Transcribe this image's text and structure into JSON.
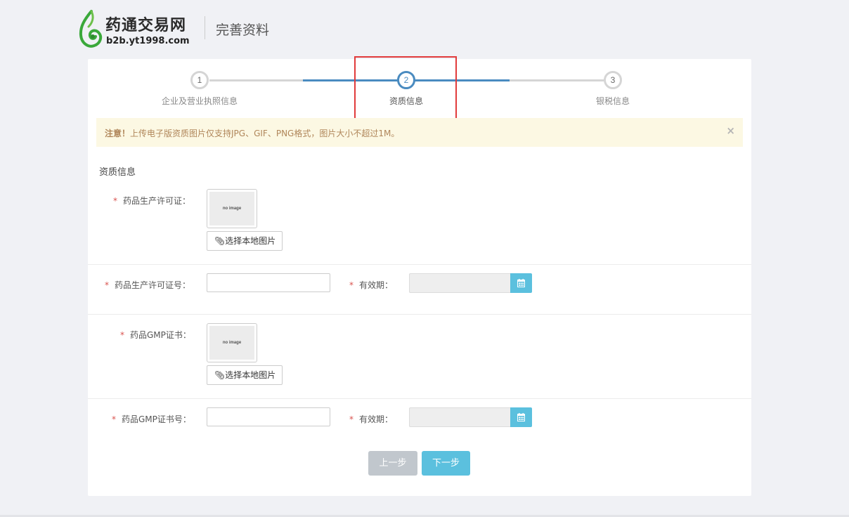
{
  "header": {
    "brand_name": "药通交易网",
    "brand_url": "b2b.yt1998.com",
    "page_title": "完善资料",
    "logo_icon": "leaf-swirl-logo"
  },
  "steps": [
    {
      "number": "1",
      "label": "企业及营业执照信息",
      "state": "done"
    },
    {
      "number": "2",
      "label": "资质信息",
      "state": "active"
    },
    {
      "number": "3",
      "label": "银税信息",
      "state": "pending"
    }
  ],
  "alert": {
    "strong": "注意！",
    "message": "上传电子版资质图片仅支持JPG、GIF、PNG格式，图片大小不超过1M。",
    "close_label": "×"
  },
  "section_title": "资质信息",
  "form": {
    "required_mark": "*",
    "manufacturing_license_label": "药品生产许可证：",
    "manufacturing_license_no_label": "药品生产许可证号：",
    "gmp_cert_label": "药品GMP证书：",
    "gmp_cert_no_label": "药品GMP证书号：",
    "validity_label": "有效期：",
    "no_image_text": "no image",
    "choose_image_label": "选择本地图片",
    "manufacturing_license_no_value": "",
    "gmp_cert_no_value": "",
    "manufacturing_validity_value": "",
    "gmp_validity_value": ""
  },
  "buttons": {
    "prev": "上一步",
    "next": "下一步"
  },
  "colors": {
    "accent": "#5bc0de",
    "step_active": "#4a8bc0",
    "alert_bg": "#fcf8e3",
    "highlight": "#e13b3b",
    "required": "#d9534f"
  }
}
